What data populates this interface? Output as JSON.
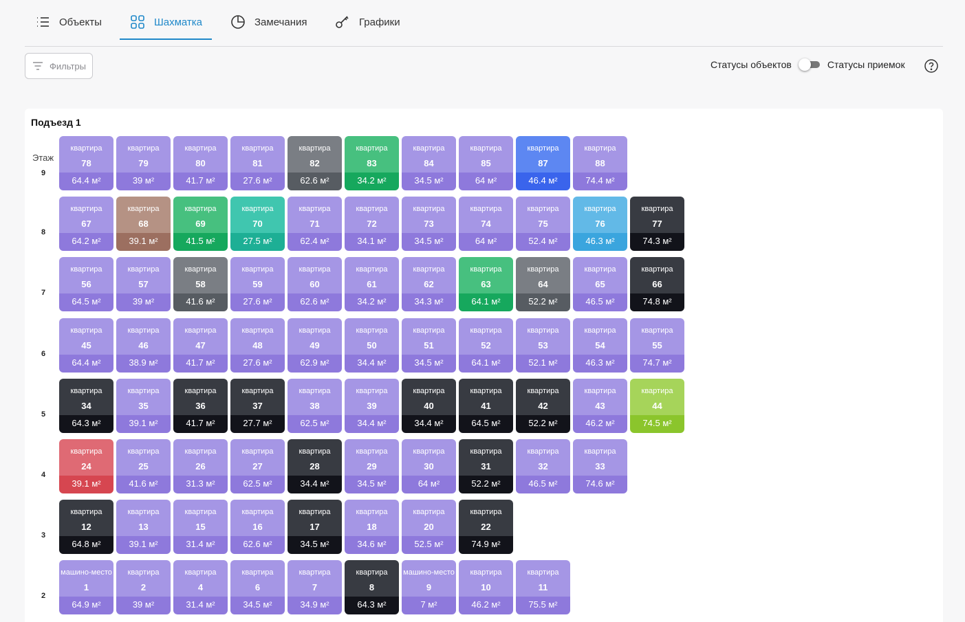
{
  "tabs": [
    {
      "label": "Объекты",
      "icon": "list-icon"
    },
    {
      "label": "Шахматка",
      "icon": "grid-icon",
      "active": true
    },
    {
      "label": "Замечания",
      "icon": "pie-chart-icon"
    },
    {
      "label": "Графики",
      "icon": "key-icon"
    }
  ],
  "toolbar": {
    "filters_label": "Фильтры",
    "toggle_left_label": "Статусы объектов",
    "toggle_right_label": "Статусы приемок",
    "toggle_state": "off"
  },
  "entrance": {
    "title": "Подъезд 1",
    "floor_header": "Этаж"
  },
  "status_colors": {
    "p": "#a596e5",
    "g": "#7a7e84",
    "e": "#47c07f",
    "b": "#5d87f2",
    "n": "#b59284",
    "t": "#40c6af",
    "s": "#62b9e7",
    "d": "#383b42",
    "l": "#a6d45a",
    "r": "#df6a74"
  },
  "floors": [
    {
      "floor": "9",
      "units": [
        {
          "type": "квартира",
          "number": "78",
          "area": "64.4 м²",
          "status": "p"
        },
        {
          "type": "квартира",
          "number": "79",
          "area": "39 м²",
          "status": "p"
        },
        {
          "type": "квартира",
          "number": "80",
          "area": "41.7 м²",
          "status": "p"
        },
        {
          "type": "квартира",
          "number": "81",
          "area": "27.6 м²",
          "status": "p"
        },
        {
          "type": "квартира",
          "number": "82",
          "area": "62.6 м²",
          "status": "g"
        },
        {
          "type": "квартира",
          "number": "83",
          "area": "34.2 м²",
          "status": "e"
        },
        {
          "type": "квартира",
          "number": "84",
          "area": "34.5 м²",
          "status": "p"
        },
        {
          "type": "квартира",
          "number": "85",
          "area": "64 м²",
          "status": "p"
        },
        {
          "type": "квартира",
          "number": "87",
          "area": "46.4 м²",
          "status": "b"
        },
        {
          "type": "квартира",
          "number": "88",
          "area": "74.4 м²",
          "status": "p"
        }
      ]
    },
    {
      "floor": "8",
      "units": [
        {
          "type": "квартира",
          "number": "67",
          "area": "64.2 м²",
          "status": "p"
        },
        {
          "type": "квартира",
          "number": "68",
          "area": "39.1 м²",
          "status": "n"
        },
        {
          "type": "квартира",
          "number": "69",
          "area": "41.5 м²",
          "status": "e"
        },
        {
          "type": "квартира",
          "number": "70",
          "area": "27.5 м²",
          "status": "t"
        },
        {
          "type": "квартира",
          "number": "71",
          "area": "62.4 м²",
          "status": "p"
        },
        {
          "type": "квартира",
          "number": "72",
          "area": "34.1 м²",
          "status": "p"
        },
        {
          "type": "квартира",
          "number": "73",
          "area": "34.5 м²",
          "status": "p"
        },
        {
          "type": "квартира",
          "number": "74",
          "area": "64 м²",
          "status": "p"
        },
        {
          "type": "квартира",
          "number": "75",
          "area": "52.4 м²",
          "status": "p"
        },
        {
          "type": "квартира",
          "number": "76",
          "area": "46.3 м²",
          "status": "s"
        },
        {
          "type": "квартира",
          "number": "77",
          "area": "74.3 м²",
          "status": "d"
        }
      ]
    },
    {
      "floor": "7",
      "units": [
        {
          "type": "квартира",
          "number": "56",
          "area": "64.5 м²",
          "status": "p"
        },
        {
          "type": "квартира",
          "number": "57",
          "area": "39 м²",
          "status": "p"
        },
        {
          "type": "квартира",
          "number": "58",
          "area": "41.6 м²",
          "status": "g"
        },
        {
          "type": "квартира",
          "number": "59",
          "area": "27.6 м²",
          "status": "p"
        },
        {
          "type": "квартира",
          "number": "60",
          "area": "62.6 м²",
          "status": "p"
        },
        {
          "type": "квартира",
          "number": "61",
          "area": "34.2 м²",
          "status": "p"
        },
        {
          "type": "квартира",
          "number": "62",
          "area": "34.3 м²",
          "status": "p"
        },
        {
          "type": "квартира",
          "number": "63",
          "area": "64.1 м²",
          "status": "e"
        },
        {
          "type": "квартира",
          "number": "64",
          "area": "52.2 м²",
          "status": "g"
        },
        {
          "type": "квартира",
          "number": "65",
          "area": "46.5 м²",
          "status": "p"
        },
        {
          "type": "квартира",
          "number": "66",
          "area": "74.8 м²",
          "status": "d"
        }
      ]
    },
    {
      "floor": "6",
      "units": [
        {
          "type": "квартира",
          "number": "45",
          "area": "64.4 м²",
          "status": "p"
        },
        {
          "type": "квартира",
          "number": "46",
          "area": "38.9 м²",
          "status": "p"
        },
        {
          "type": "квартира",
          "number": "47",
          "area": "41.7 м²",
          "status": "p"
        },
        {
          "type": "квартира",
          "number": "48",
          "area": "27.6 м²",
          "status": "p"
        },
        {
          "type": "квартира",
          "number": "49",
          "area": "62.9 м²",
          "status": "p"
        },
        {
          "type": "квартира",
          "number": "50",
          "area": "34.4 м²",
          "status": "p"
        },
        {
          "type": "квартира",
          "number": "51",
          "area": "34.5 м²",
          "status": "p"
        },
        {
          "type": "квартира",
          "number": "52",
          "area": "64.1 м²",
          "status": "p"
        },
        {
          "type": "квартира",
          "number": "53",
          "area": "52.1 м²",
          "status": "p"
        },
        {
          "type": "квартира",
          "number": "54",
          "area": "46.3 м²",
          "status": "p"
        },
        {
          "type": "квартира",
          "number": "55",
          "area": "74.7 м²",
          "status": "p"
        }
      ]
    },
    {
      "floor": "5",
      "units": [
        {
          "type": "квартира",
          "number": "34",
          "area": "64.3 м²",
          "status": "d"
        },
        {
          "type": "квартира",
          "number": "35",
          "area": "39.1 м²",
          "status": "p"
        },
        {
          "type": "квартира",
          "number": "36",
          "area": "41.7 м²",
          "status": "d"
        },
        {
          "type": "квартира",
          "number": "37",
          "area": "27.7 м²",
          "status": "d"
        },
        {
          "type": "квартира",
          "number": "38",
          "area": "62.5 м²",
          "status": "p"
        },
        {
          "type": "квартира",
          "number": "39",
          "area": "34.4 м²",
          "status": "p"
        },
        {
          "type": "квартира",
          "number": "40",
          "area": "34.4 м²",
          "status": "d"
        },
        {
          "type": "квартира",
          "number": "41",
          "area": "64.5 м²",
          "status": "d"
        },
        {
          "type": "квартира",
          "number": "42",
          "area": "52.2 м²",
          "status": "d"
        },
        {
          "type": "квартира",
          "number": "43",
          "area": "46.2 м²",
          "status": "p"
        },
        {
          "type": "квартира",
          "number": "44",
          "area": "74.5 м²",
          "status": "l"
        }
      ]
    },
    {
      "floor": "4",
      "units": [
        {
          "type": "квартира",
          "number": "24",
          "area": "39.1 м²",
          "status": "r"
        },
        {
          "type": "квартира",
          "number": "25",
          "area": "41.6 м²",
          "status": "p"
        },
        {
          "type": "квартира",
          "number": "26",
          "area": "31.3 м²",
          "status": "p"
        },
        {
          "type": "квартира",
          "number": "27",
          "area": "62.5 м²",
          "status": "p"
        },
        {
          "type": "квартира",
          "number": "28",
          "area": "34.4 м²",
          "status": "d"
        },
        {
          "type": "квартира",
          "number": "29",
          "area": "34.5 м²",
          "status": "p"
        },
        {
          "type": "квартира",
          "number": "30",
          "area": "64 м²",
          "status": "p"
        },
        {
          "type": "квартира",
          "number": "31",
          "area": "52.2 м²",
          "status": "d"
        },
        {
          "type": "квартира",
          "number": "32",
          "area": "46.5 м²",
          "status": "p"
        },
        {
          "type": "квартира",
          "number": "33",
          "area": "74.6 м²",
          "status": "p"
        }
      ]
    },
    {
      "floor": "3",
      "units": [
        {
          "type": "квартира",
          "number": "12",
          "area": "64.8 м²",
          "status": "d"
        },
        {
          "type": "квартира",
          "number": "13",
          "area": "39.1 м²",
          "status": "p"
        },
        {
          "type": "квартира",
          "number": "15",
          "area": "31.4 м²",
          "status": "p"
        },
        {
          "type": "квартира",
          "number": "16",
          "area": "62.6 м²",
          "status": "p"
        },
        {
          "type": "квартира",
          "number": "17",
          "area": "34.5 м²",
          "status": "d"
        },
        {
          "type": "квартира",
          "number": "18",
          "area": "34.6 м²",
          "status": "p"
        },
        {
          "type": "квартира",
          "number": "20",
          "area": "52.5 м²",
          "status": "p"
        },
        {
          "type": "квартира",
          "number": "22",
          "area": "74.9 м²",
          "status": "d"
        }
      ]
    },
    {
      "floor": "2",
      "units": [
        {
          "type": "машино-место",
          "number": "1",
          "area": "64.9 м²",
          "status": "p"
        },
        {
          "type": "квартира",
          "number": "2",
          "area": "39 м²",
          "status": "p"
        },
        {
          "type": "квартира",
          "number": "4",
          "area": "31.4 м²",
          "status": "p"
        },
        {
          "type": "квартира",
          "number": "6",
          "area": "34.5 м²",
          "status": "p"
        },
        {
          "type": "квартира",
          "number": "7",
          "area": "34.9 м²",
          "status": "p"
        },
        {
          "type": "квартира",
          "number": "8",
          "area": "64.3 м²",
          "status": "d"
        },
        {
          "type": "машино-место",
          "number": "9",
          "area": "7 м²",
          "status": "p"
        },
        {
          "type": "квартира",
          "number": "10",
          "area": "46.2 м²",
          "status": "p"
        },
        {
          "type": "квартира",
          "number": "11",
          "area": "75.5 м²",
          "status": "p"
        }
      ]
    }
  ]
}
